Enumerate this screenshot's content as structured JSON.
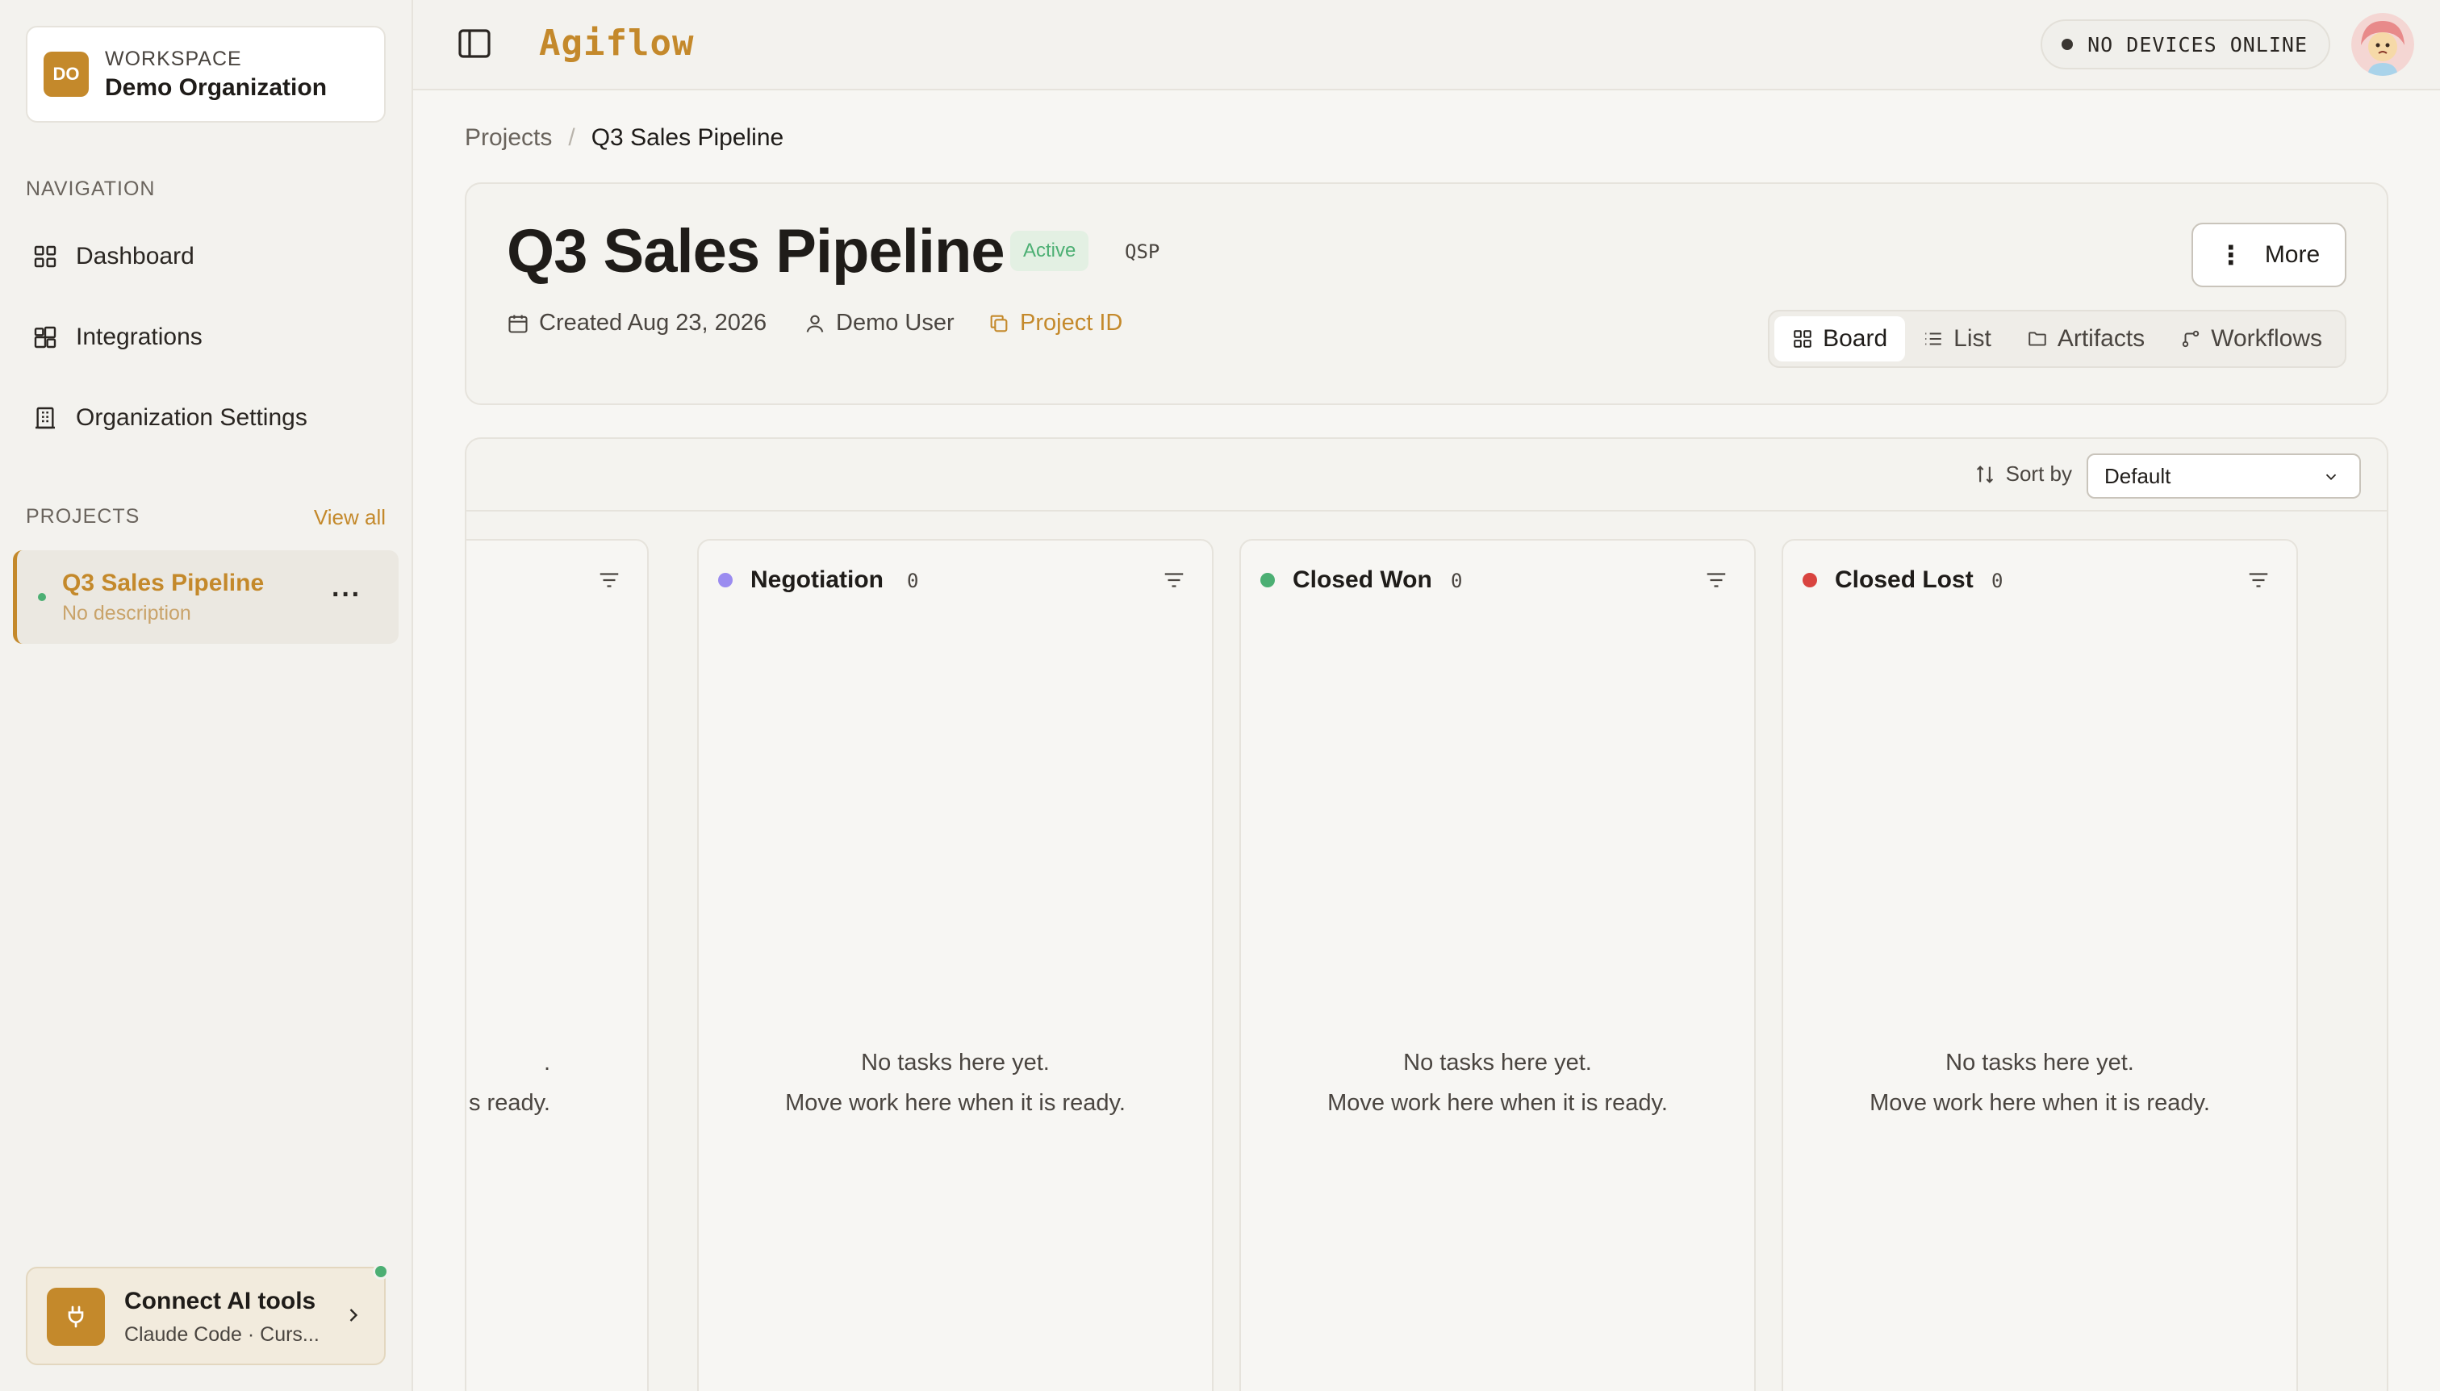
{
  "workspace": {
    "initials": "DO",
    "kicker": "WORKSPACE",
    "name": "Demo Organization"
  },
  "navigation": {
    "label": "NAVIGATION",
    "items": [
      {
        "label": "Dashboard",
        "icon": "grid-icon"
      },
      {
        "label": "Integrations",
        "icon": "integrations-icon"
      },
      {
        "label": "Organization Settings",
        "icon": "building-icon"
      }
    ]
  },
  "projects": {
    "label": "PROJECTS",
    "view_all": "View all",
    "items": [
      {
        "name": "Q3 Sales Pipeline",
        "description": "No description"
      }
    ]
  },
  "connect": {
    "title": "Connect AI tools",
    "subtitle": "Claude Code · Curs..."
  },
  "topbar": {
    "logo": "Agiflow",
    "devices_status": "NO DEVICES ONLINE"
  },
  "breadcrumb": {
    "parent": "Projects",
    "separator": "/",
    "current": "Q3 Sales Pipeline"
  },
  "project": {
    "title": "Q3 Sales Pipeline",
    "status": "Active",
    "code": "QSP",
    "created": "Created Aug 23, 2026",
    "owner": "Demo User",
    "project_id_label": "Project ID",
    "more_label": "More"
  },
  "view_tabs": [
    {
      "label": "Board",
      "icon": "board-icon",
      "active": true
    },
    {
      "label": "List",
      "icon": "list-icon",
      "active": false
    },
    {
      "label": "Artifacts",
      "icon": "folder-icon",
      "active": false
    },
    {
      "label": "Workflows",
      "icon": "workflow-icon",
      "active": false
    }
  ],
  "board": {
    "sort_label": "Sort by",
    "sort_value": "Default",
    "partial_column": {
      "empty_line1": ".",
      "empty_line2": "s ready."
    },
    "columns": [
      {
        "name": "Negotiation",
        "count": "0",
        "color": "#9b8cf0",
        "empty_line1": "No tasks here yet.",
        "empty_line2": "Move work here when it is ready."
      },
      {
        "name": "Closed Won",
        "count": "0",
        "color": "#4caf73",
        "empty_line1": "No tasks here yet.",
        "empty_line2": "Move work here when it is ready."
      },
      {
        "name": "Closed Lost",
        "count": "0",
        "color": "#d9443f",
        "empty_line1": "No tasks here yet.",
        "empty_line2": "Move work here when it is ready."
      }
    ]
  },
  "colors": {
    "accent": "#c4892b",
    "success": "#4caf73",
    "danger": "#d9443f",
    "violet": "#9b8cf0"
  }
}
